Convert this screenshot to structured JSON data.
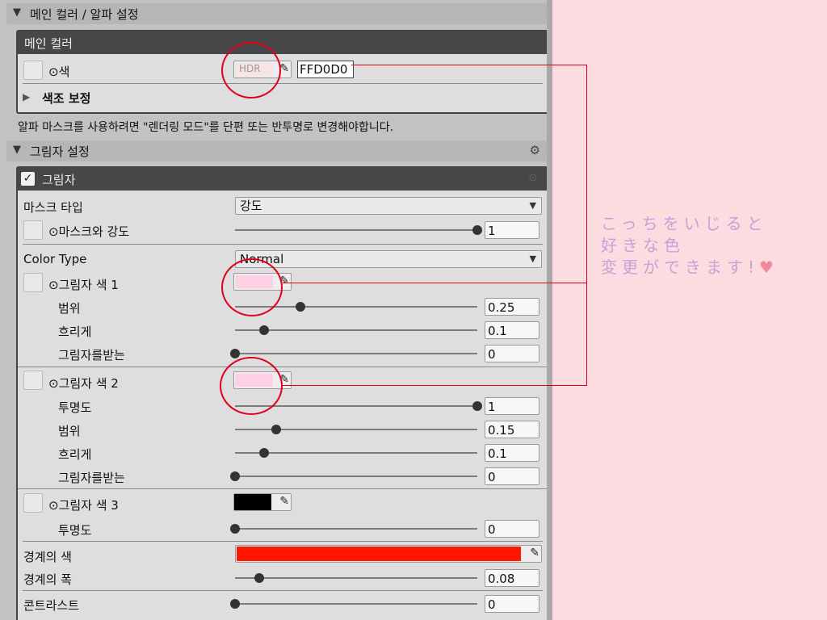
{
  "section_main": {
    "title": "메인 컬러 / 알파 설정"
  },
  "main_box": {
    "title": "메인 컬러",
    "color_label": "⊙색",
    "hdr_label": "HDR",
    "hex_value": "FFD0D0",
    "hue_label": "색조 보정"
  },
  "alpha_note": "알파 마스크를 사용하려면 \"렌더링 모드\"를 단편 또는 반투명로 변경해야합니다.",
  "section_shadow": {
    "title": "그림자 설정"
  },
  "shadow_box": {
    "title": "그림자",
    "mask_type_label": "마스크 타입",
    "mask_type_value": "강도",
    "mask_strength_label": "⊙마스크와 강도",
    "mask_strength_value": "1",
    "color_type_label": "Color Type",
    "color_type_value": "Normal",
    "shadow1": {
      "label": "⊙그림자 색 1",
      "range_label": "범위",
      "range_value": "0.25",
      "blur_label": "흐리게",
      "blur_value": "0.1",
      "receive_label": "그림자를받는",
      "receive_value": "0"
    },
    "shadow2": {
      "label": "⊙그림자 색 2",
      "opacity_label": "투명도",
      "opacity_value": "1",
      "range_label": "범위",
      "range_value": "0.15",
      "blur_label": "흐리게",
      "blur_value": "0.1",
      "receive_label": "그림자를받는",
      "receive_value": "0"
    },
    "shadow3": {
      "label": "⊙그림자 색 3",
      "opacity_label": "투명도",
      "opacity_value": "0"
    },
    "border_color_label": "경계의 색",
    "border_width_label": "경계의 폭",
    "border_width_value": "0.08",
    "contrast_label": "콘트라스트",
    "contrast_value": "0"
  },
  "slider_levels": {
    "mask_strength": 1.0,
    "shadow1_range": 0.27,
    "shadow1_blur": 0.12,
    "shadow1_receive": 0.0,
    "shadow2_opacity": 1.0,
    "shadow2_range": 0.17,
    "shadow2_blur": 0.12,
    "shadow2_receive": 0.0,
    "shadow3_opacity": 0.0,
    "border_width": 0.1,
    "contrast": 0.0
  },
  "colors": {
    "main_color": "#ffd0d0",
    "shadow1_color": "#fdd0e4",
    "shadow2_color": "#fdd0e4",
    "shadow3_color": "#000000",
    "border_color": "#ff1500",
    "highlight": "#e0001a",
    "annotation_text": "#c9a0d8"
  },
  "icons": [
    "triangle-down-icon",
    "triangle-right-icon",
    "gear-icon",
    "eyedropper-icon",
    "checkbox-checked-icon",
    "heart-icon"
  ],
  "annotation": {
    "line1": "こっちをいじると",
    "line2": "好きな色",
    "line3": "変更ができます!"
  }
}
